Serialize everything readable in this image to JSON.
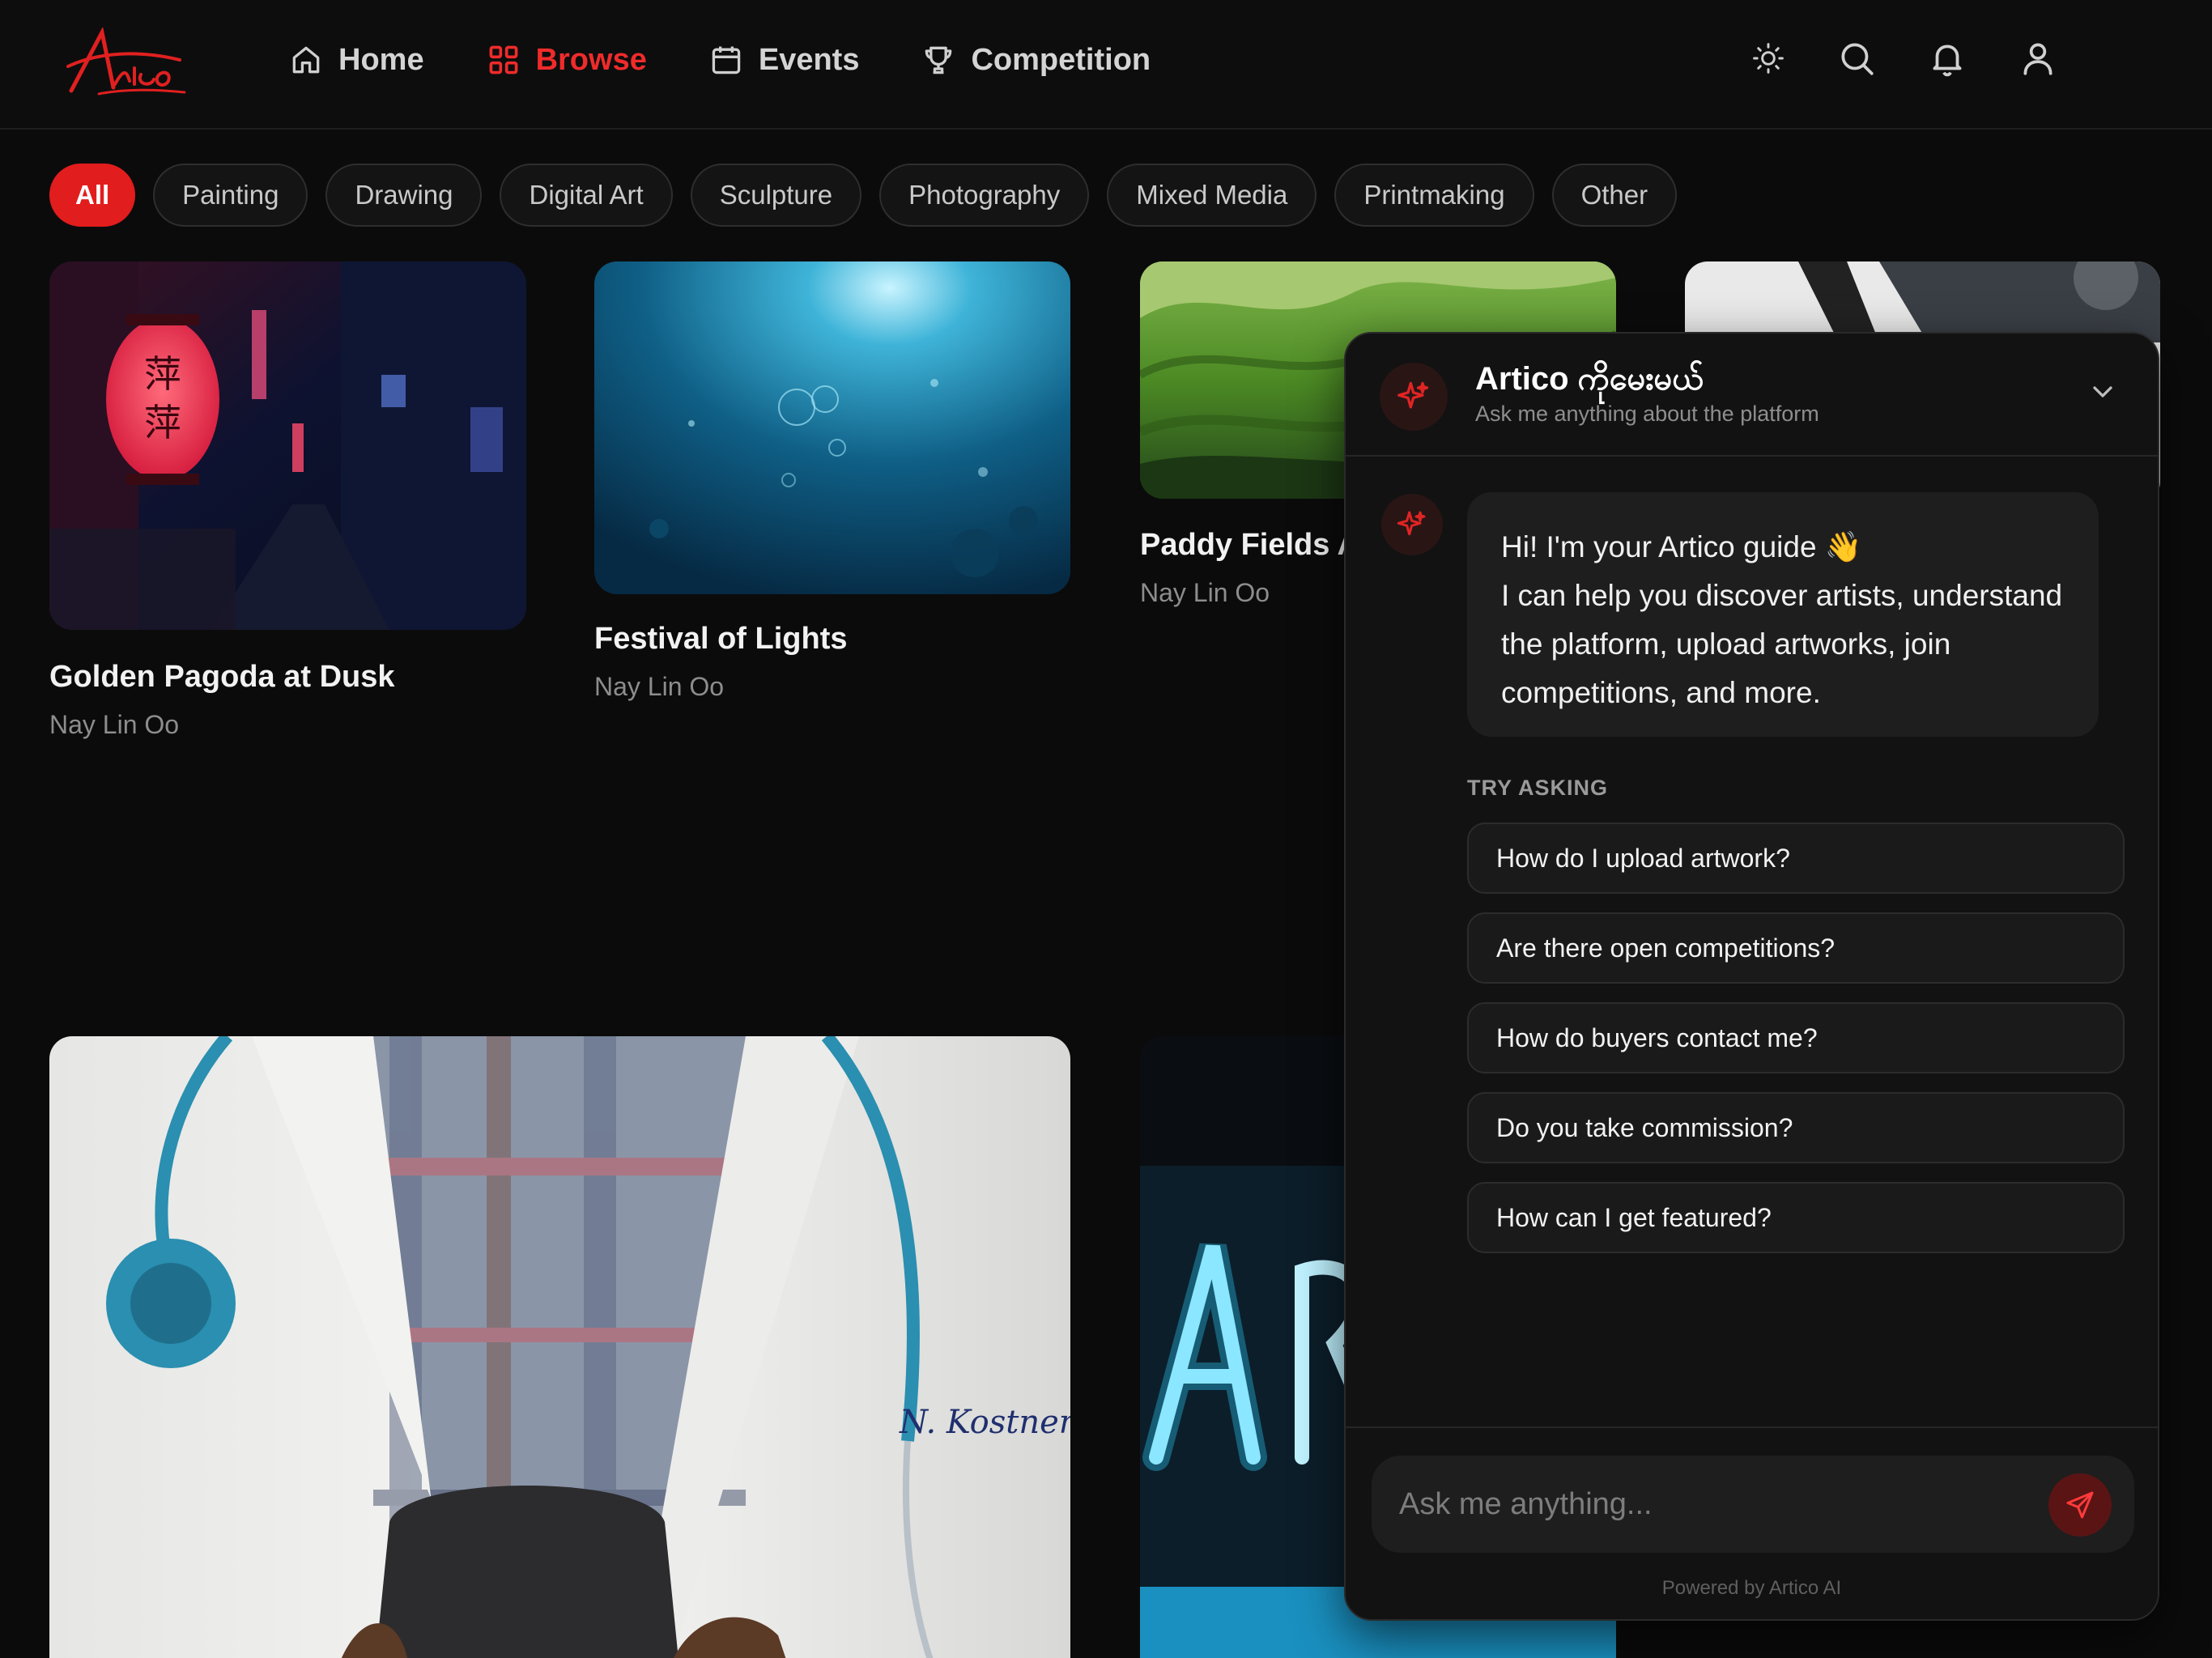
{
  "brand": {
    "logo_text": "Artico",
    "accent": "#ef2b2b"
  },
  "nav": {
    "items": [
      {
        "label": "Home",
        "icon": "home-icon"
      },
      {
        "label": "Browse",
        "icon": "grid-icon",
        "active": true
      },
      {
        "label": "Events",
        "icon": "calendar-icon"
      },
      {
        "label": "Competition",
        "icon": "trophy-icon"
      }
    ],
    "right_icons": [
      "sun-icon",
      "search-icon",
      "bell-icon",
      "user-icon"
    ]
  },
  "filters": [
    "All",
    "Painting",
    "Drawing",
    "Digital Art",
    "Sculpture",
    "Photography",
    "Mixed Media",
    "Printmaking",
    "Other"
  ],
  "artworks": [
    {
      "title": "Golden Pagoda at Dusk",
      "artist": "Nay Lin Oo"
    },
    {
      "title": "Festival of Lights",
      "artist": "Nay Lin Oo"
    },
    {
      "title": "Paddy Fields A",
      "artist": "Nay Lin Oo"
    }
  ],
  "chat": {
    "title": "Artico ကိုမေးမယ်",
    "subtitle": "Ask me anything about the platform",
    "greeting_line1": "Hi! I'm your Artico guide 👋",
    "greeting_line2": "I can help you discover artists, understand the platform, upload artworks, join competitions, and more.",
    "try_asking": "TRY ASKING",
    "suggestions": [
      "How do I upload artwork?",
      "Are there open competitions?",
      "How do buyers contact me?",
      "Do you take commission?",
      "How can I get featured?"
    ],
    "input_placeholder": "Ask me anything...",
    "powered_by": "Powered by Artico AI"
  }
}
